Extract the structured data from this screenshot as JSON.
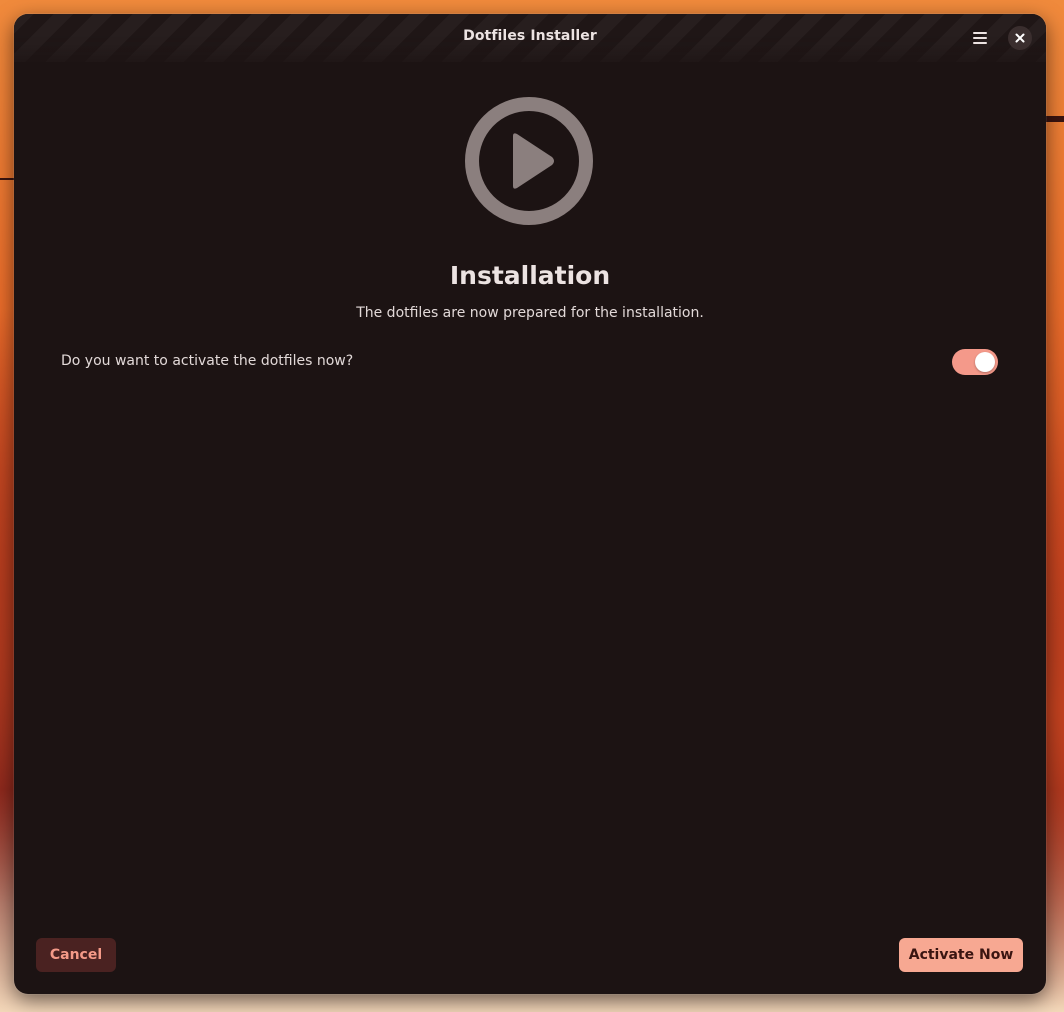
{
  "window": {
    "title": "Dotfiles Installer"
  },
  "header": {
    "menu_icon": "hamburger-menu-icon",
    "close_icon": "close-icon"
  },
  "main": {
    "hero_icon": "play-circle-icon",
    "heading": "Installation",
    "subheading": "The dotfiles are now prepared for the installation.",
    "activate_question": "Do you want to activate the dotfiles now?",
    "activate_toggle_on": true
  },
  "footer": {
    "cancel_label": "Cancel",
    "activate_label": "Activate Now"
  },
  "colors": {
    "window_bg": "#1c1313",
    "accent": "#f7a892",
    "toggle_on": "#f4998a",
    "cancel_bg": "#4a2221",
    "cancel_text": "#f49a88",
    "hero_icon": "#8b7f7e"
  }
}
